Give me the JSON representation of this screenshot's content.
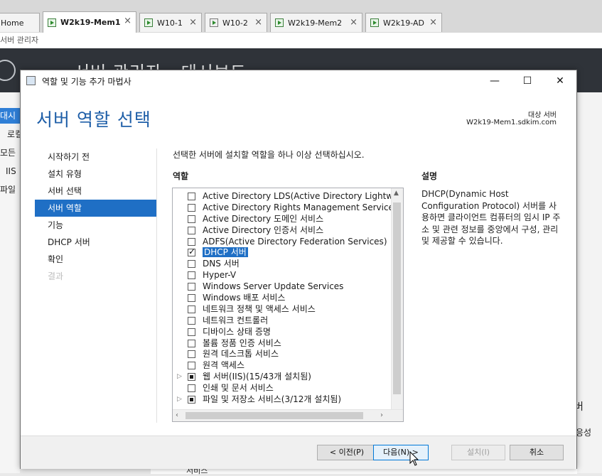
{
  "tabs": [
    {
      "label": "Home",
      "active": false
    },
    {
      "label": "W2k19-Mem1",
      "active": true
    },
    {
      "label": "W10-1",
      "active": false
    },
    {
      "label": "W10-2",
      "active": false
    },
    {
      "label": "W2k19-Mem2",
      "active": false
    },
    {
      "label": "W2k19-AD",
      "active": false
    }
  ],
  "host": {
    "window_title": "서버 관리자",
    "header_title": "서버 관리자 • 대시보드",
    "sidebar": [
      "대시",
      "로컬",
      "모든",
      "IIS",
      "파일"
    ],
    "right_text_1": "버",
    "right_text_2": "응성",
    "bottom_text": "서비스"
  },
  "dialog": {
    "caption": "역할 및 기능 추가 마법사",
    "minimize": "—",
    "maximize": "☐",
    "close": "✕",
    "page_title": "서버 역할 선택",
    "dest_label": "대상 서버",
    "dest_value": "W2k19-Mem1.sdkim.com",
    "steps": [
      {
        "label": "시작하기 전",
        "state": "normal"
      },
      {
        "label": "설치 유형",
        "state": "normal"
      },
      {
        "label": "서버 선택",
        "state": "normal"
      },
      {
        "label": "서버 역할",
        "state": "selected"
      },
      {
        "label": "기능",
        "state": "normal"
      },
      {
        "label": "DHCP 서버",
        "state": "normal"
      },
      {
        "label": "확인",
        "state": "normal"
      },
      {
        "label": "결과",
        "state": "disabled"
      }
    ],
    "instruction": "선택한 서버에 설치할 역할을 하나 이상 선택하십시오.",
    "roles_header": "역할",
    "description_header": "설명",
    "description_text": "DHCP(Dynamic Host Configuration Protocol) 서버를 사용하면 클라이언트 컴퓨터의 임시 IP 주소 및 관련 정보를 중앙에서 구성, 관리 및 제공할 수 있습니다.",
    "roles": [
      {
        "label": "Active Directory LDS(Active Directory Lightweight Directory Services)",
        "state": "unchecked",
        "expandable": false
      },
      {
        "label": "Active Directory Rights Management Services",
        "state": "unchecked",
        "expandable": false
      },
      {
        "label": "Active Directory 도메인 서비스",
        "state": "unchecked",
        "expandable": false
      },
      {
        "label": "Active Directory 인증서 서비스",
        "state": "unchecked",
        "expandable": false
      },
      {
        "label": "ADFS(Active Directory Federation Services)",
        "state": "unchecked",
        "expandable": false
      },
      {
        "label": "DHCP 서버",
        "state": "checked",
        "expandable": false,
        "selected": true
      },
      {
        "label": "DNS 서버",
        "state": "unchecked",
        "expandable": false
      },
      {
        "label": "Hyper-V",
        "state": "unchecked",
        "expandable": false
      },
      {
        "label": "Windows Server Update Services",
        "state": "unchecked",
        "expandable": false
      },
      {
        "label": "Windows 배포 서비스",
        "state": "unchecked",
        "expandable": false
      },
      {
        "label": "네트워크 정책 및 액세스 서비스",
        "state": "unchecked",
        "expandable": false
      },
      {
        "label": "네트워크 컨트롤러",
        "state": "unchecked",
        "expandable": false
      },
      {
        "label": "디바이스 상태 증명",
        "state": "unchecked",
        "expandable": false
      },
      {
        "label": "볼륨 정품 인증 서비스",
        "state": "unchecked",
        "expandable": false
      },
      {
        "label": "원격 데스크톱 서비스",
        "state": "unchecked",
        "expandable": false
      },
      {
        "label": "원격 액세스",
        "state": "unchecked",
        "expandable": false
      },
      {
        "label": "웹 서버(IIS)(15/43개 설치됨)",
        "state": "partial",
        "expandable": true
      },
      {
        "label": "인쇄 및 문서 서비스",
        "state": "unchecked",
        "expandable": false
      },
      {
        "label": "파일 및 저장소 서비스(3/12개 설치됨)",
        "state": "partial",
        "expandable": true
      }
    ],
    "buttons": {
      "previous": "< 이전(P)",
      "next": "다음(N) >",
      "install": "설치(I)",
      "cancel": "취소"
    }
  }
}
